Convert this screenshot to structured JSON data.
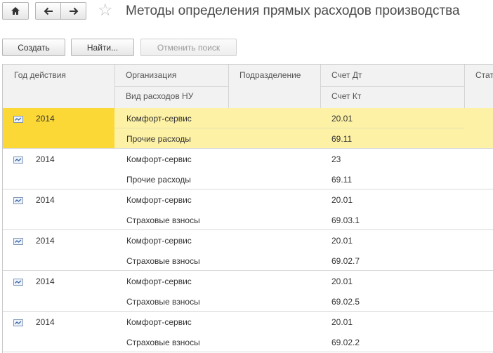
{
  "window": {
    "title": "Методы определения прямых расходов производства"
  },
  "toolbar": {
    "create_label": "Создать",
    "find_label": "Найти...",
    "cancel_search_label": "Отменить поиск"
  },
  "table": {
    "headers": {
      "year": "Год действия",
      "org": "Организация",
      "expense_type": "Вид расходов НУ",
      "division": "Подразделение",
      "debit": "Счет Дт",
      "credit": "Счет Кт",
      "status": "Стат"
    },
    "rows": [
      {
        "year": "2014",
        "org": "Комфорт-сервис",
        "expense": "Прочие расходы",
        "division": "",
        "debit": "20.01",
        "credit": "69.11",
        "selected": true
      },
      {
        "year": "2014",
        "org": "Комфорт-сервис",
        "expense": "Прочие расходы",
        "division": "",
        "debit": "23",
        "credit": "69.11",
        "selected": false
      },
      {
        "year": "2014",
        "org": "Комфорт-сервис",
        "expense": "Страховые взносы",
        "division": "",
        "debit": "20.01",
        "credit": "69.03.1",
        "selected": false
      },
      {
        "year": "2014",
        "org": "Комфорт-сервис",
        "expense": "Страховые взносы",
        "division": "",
        "debit": "20.01",
        "credit": "69.02.7",
        "selected": false
      },
      {
        "year": "2014",
        "org": "Комфорт-сервис",
        "expense": "Страховые взносы",
        "division": "",
        "debit": "20.01",
        "credit": "69.02.5",
        "selected": false
      },
      {
        "year": "2014",
        "org": "Комфорт-сервис",
        "expense": "Страховые взносы",
        "division": "",
        "debit": "20.01",
        "credit": "69.02.2",
        "selected": false
      }
    ]
  },
  "icons": {
    "home": "home-icon",
    "back": "arrow-left-icon",
    "forward": "arrow-right-icon",
    "favorite": "star-icon",
    "row": "record-icon"
  },
  "colors": {
    "selected_first_cell": "#fbd835",
    "selected_row": "#fdf1a6"
  }
}
